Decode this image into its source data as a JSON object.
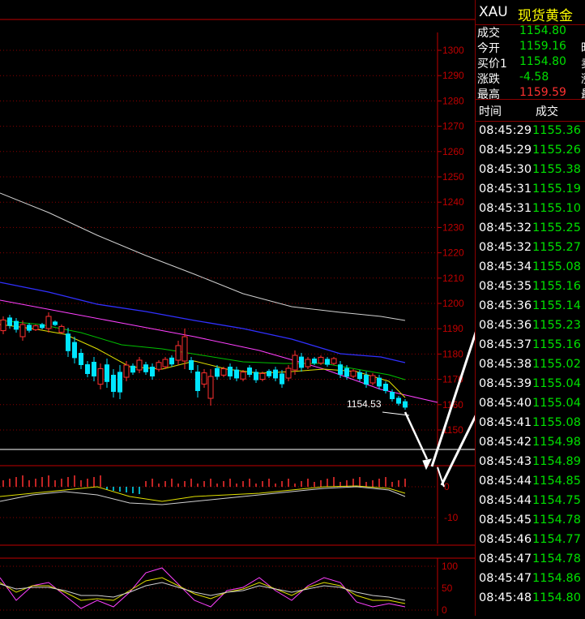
{
  "header": {
    "symbol": "XAU",
    "name": "现货黄金"
  },
  "quote": [
    {
      "label": "成交",
      "value": "1154.80",
      "color": "green",
      "extra": ""
    },
    {
      "label": "今开",
      "value": "1159.16",
      "color": "green",
      "extra": "昨"
    },
    {
      "label": "买价1",
      "value": "1154.80",
      "color": "green",
      "extra": "卖"
    },
    {
      "label": "涨跌",
      "value": "-4.58",
      "color": "green",
      "extra": "涨"
    },
    {
      "label": "最高",
      "value": "1159.59",
      "color": "red",
      "extra": "最"
    }
  ],
  "ticks_header": {
    "time": "时间",
    "price": "成交"
  },
  "ticks": [
    {
      "time": "08:45:29",
      "price": "1155.36"
    },
    {
      "time": "08:45:29",
      "price": "1155.26"
    },
    {
      "time": "08:45:30",
      "price": "1155.38"
    },
    {
      "time": "08:45:31",
      "price": "1155.19"
    },
    {
      "time": "08:45:31",
      "price": "1155.10"
    },
    {
      "time": "08:45:32",
      "price": "1155.25"
    },
    {
      "time": "08:45:32",
      "price": "1155.27"
    },
    {
      "time": "08:45:34",
      "price": "1155.08"
    },
    {
      "time": "08:45:35",
      "price": "1155.16"
    },
    {
      "time": "08:45:36",
      "price": "1155.14"
    },
    {
      "time": "08:45:36",
      "price": "1155.23"
    },
    {
      "time": "08:45:37",
      "price": "1155.16"
    },
    {
      "time": "08:45:38",
      "price": "1155.02"
    },
    {
      "time": "08:45:39",
      "price": "1155.04"
    },
    {
      "time": "08:45:40",
      "price": "1155.04"
    },
    {
      "time": "08:45:41",
      "price": "1155.08"
    },
    {
      "time": "08:45:42",
      "price": "1154.98"
    },
    {
      "time": "08:45:43",
      "price": "1154.89"
    },
    {
      "time": "08:45:44",
      "price": "1154.85"
    },
    {
      "time": "08:45:44",
      "price": "1154.75"
    },
    {
      "time": "08:45:45",
      "price": "1154.78"
    },
    {
      "time": "08:45:46",
      "price": "1154.77"
    },
    {
      "time": "08:45:47",
      "price": "1154.78"
    },
    {
      "time": "08:45:47",
      "price": "1154.86"
    },
    {
      "time": "08:45:48",
      "price": "1154.80"
    }
  ],
  "price_axis": [
    "1300",
    "1290",
    "1280",
    "1270",
    "1260",
    "1250",
    "1240",
    "1230",
    "1220",
    "1210",
    "1200",
    "1190",
    "1180",
    "1170",
    "1160",
    "1150"
  ],
  "last_low_label": "1154.53",
  "macd_axis": [
    "0",
    "-10"
  ],
  "kdj_axis": [
    "100",
    "50",
    "0"
  ],
  "colors": {
    "up": "#ff3030",
    "down": "#00e5ff",
    "axis": "#c00000",
    "ma_white": "#d0d0d0",
    "ma_blue": "#3030ff",
    "ma_magenta": "#ff40ff",
    "ma_yellow": "#e0e000",
    "ma_green": "#00c000"
  }
}
